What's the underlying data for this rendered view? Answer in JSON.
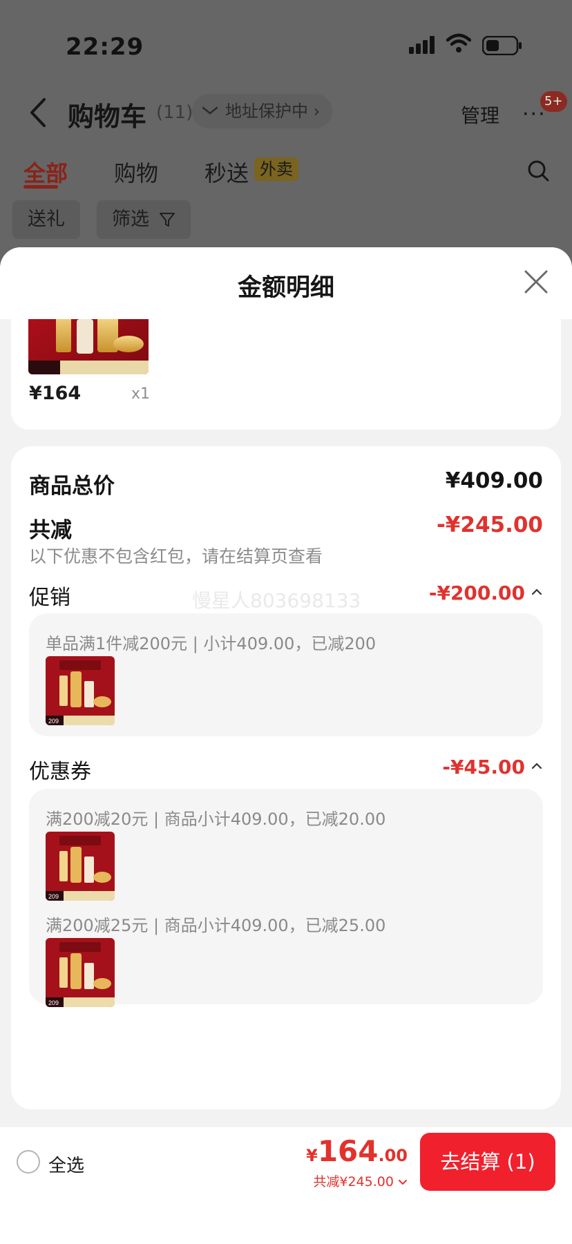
{
  "status_bar": {
    "time": "22:29"
  },
  "nav": {
    "title": "购物车",
    "count": "(11)",
    "address_chip": "地址保护中 ›",
    "manage": "管理",
    "more": "···",
    "more_badge": "5+"
  },
  "tabs": [
    {
      "label": "全部",
      "active": true
    },
    {
      "label": "购物",
      "active": false
    },
    {
      "label": "秒送",
      "active": false,
      "tag": "外卖"
    }
  ],
  "chips": [
    {
      "label": "送礼"
    },
    {
      "label": "筛选"
    }
  ],
  "sheet": {
    "title": "金额明细",
    "top_item": {
      "price": "¥164",
      "qty": "x1"
    },
    "summary": {
      "goods_total_label": "商品总价",
      "goods_total_value": "¥409.00",
      "reduce_label": "共减",
      "reduce_value": "-¥245.00",
      "reduce_note": "以下优惠不包含红包，请在结算页查看",
      "watermark": "慢星人803698133"
    },
    "promotion": {
      "label": "促销",
      "value": "-¥200.00",
      "lines": [
        {
          "text": "单品满1件减200元 | 小计409.00，已减200"
        }
      ]
    },
    "coupon": {
      "label": "优惠券",
      "value": "-¥45.00",
      "lines": [
        {
          "text": "满200减20元 | 商品小计409.00，已减20.00"
        },
        {
          "text": "满200减25元 | 商品小计409.00，已减25.00"
        }
      ]
    },
    "product_thumb_badge": "209"
  },
  "bottom_bar": {
    "select_all": "全选",
    "price_currency": "¥",
    "price_int": "164",
    "price_dec": ".00",
    "discount": "共减¥245.00",
    "checkout": "去结算 (1)"
  },
  "colors": {
    "accent_red": "#e0322e",
    "checkout_red": "#f1202d",
    "tab_active_dimmed": "#8a2219"
  }
}
